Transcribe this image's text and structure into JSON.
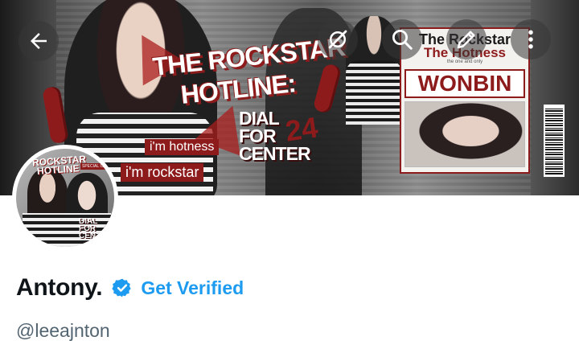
{
  "banner": {
    "title_line1": "THE ROCKSTAR",
    "title_line2": "HOTLINE:",
    "dial_words": [
      "DIAL",
      "FOR",
      "CENTER"
    ],
    "dial_number": "24",
    "tag_hotness": "i'm hotness",
    "tag_rockstar": "i'm rockstar",
    "magazine": {
      "title1": "The Rockstar",
      "title2": "The Hotness",
      "subtitle": "the one and only",
      "name": "WONBIN"
    }
  },
  "controls": {
    "back": "arrow-left-icon",
    "mute": "bell-slash-icon",
    "search": "search-icon",
    "edit": "pencil-icon",
    "more": "more-vertical-icon"
  },
  "avatar": {
    "title_line1": "ROCKSTAR",
    "title_line2": "HOTLINE",
    "badge": "SPECIAL ISSUE",
    "dial_words": [
      "DIAL",
      "FOR",
      "CEN"
    ]
  },
  "profile": {
    "display_name": "Antony.",
    "verified_badge": "verified-check-icon",
    "get_verified_label": "Get Verified",
    "handle": "@leeajnton"
  },
  "colors": {
    "accent_blue": "#1d9bf0",
    "brand_red": "#8d1b1b",
    "text_primary": "#0f1419",
    "text_secondary": "#536471"
  }
}
